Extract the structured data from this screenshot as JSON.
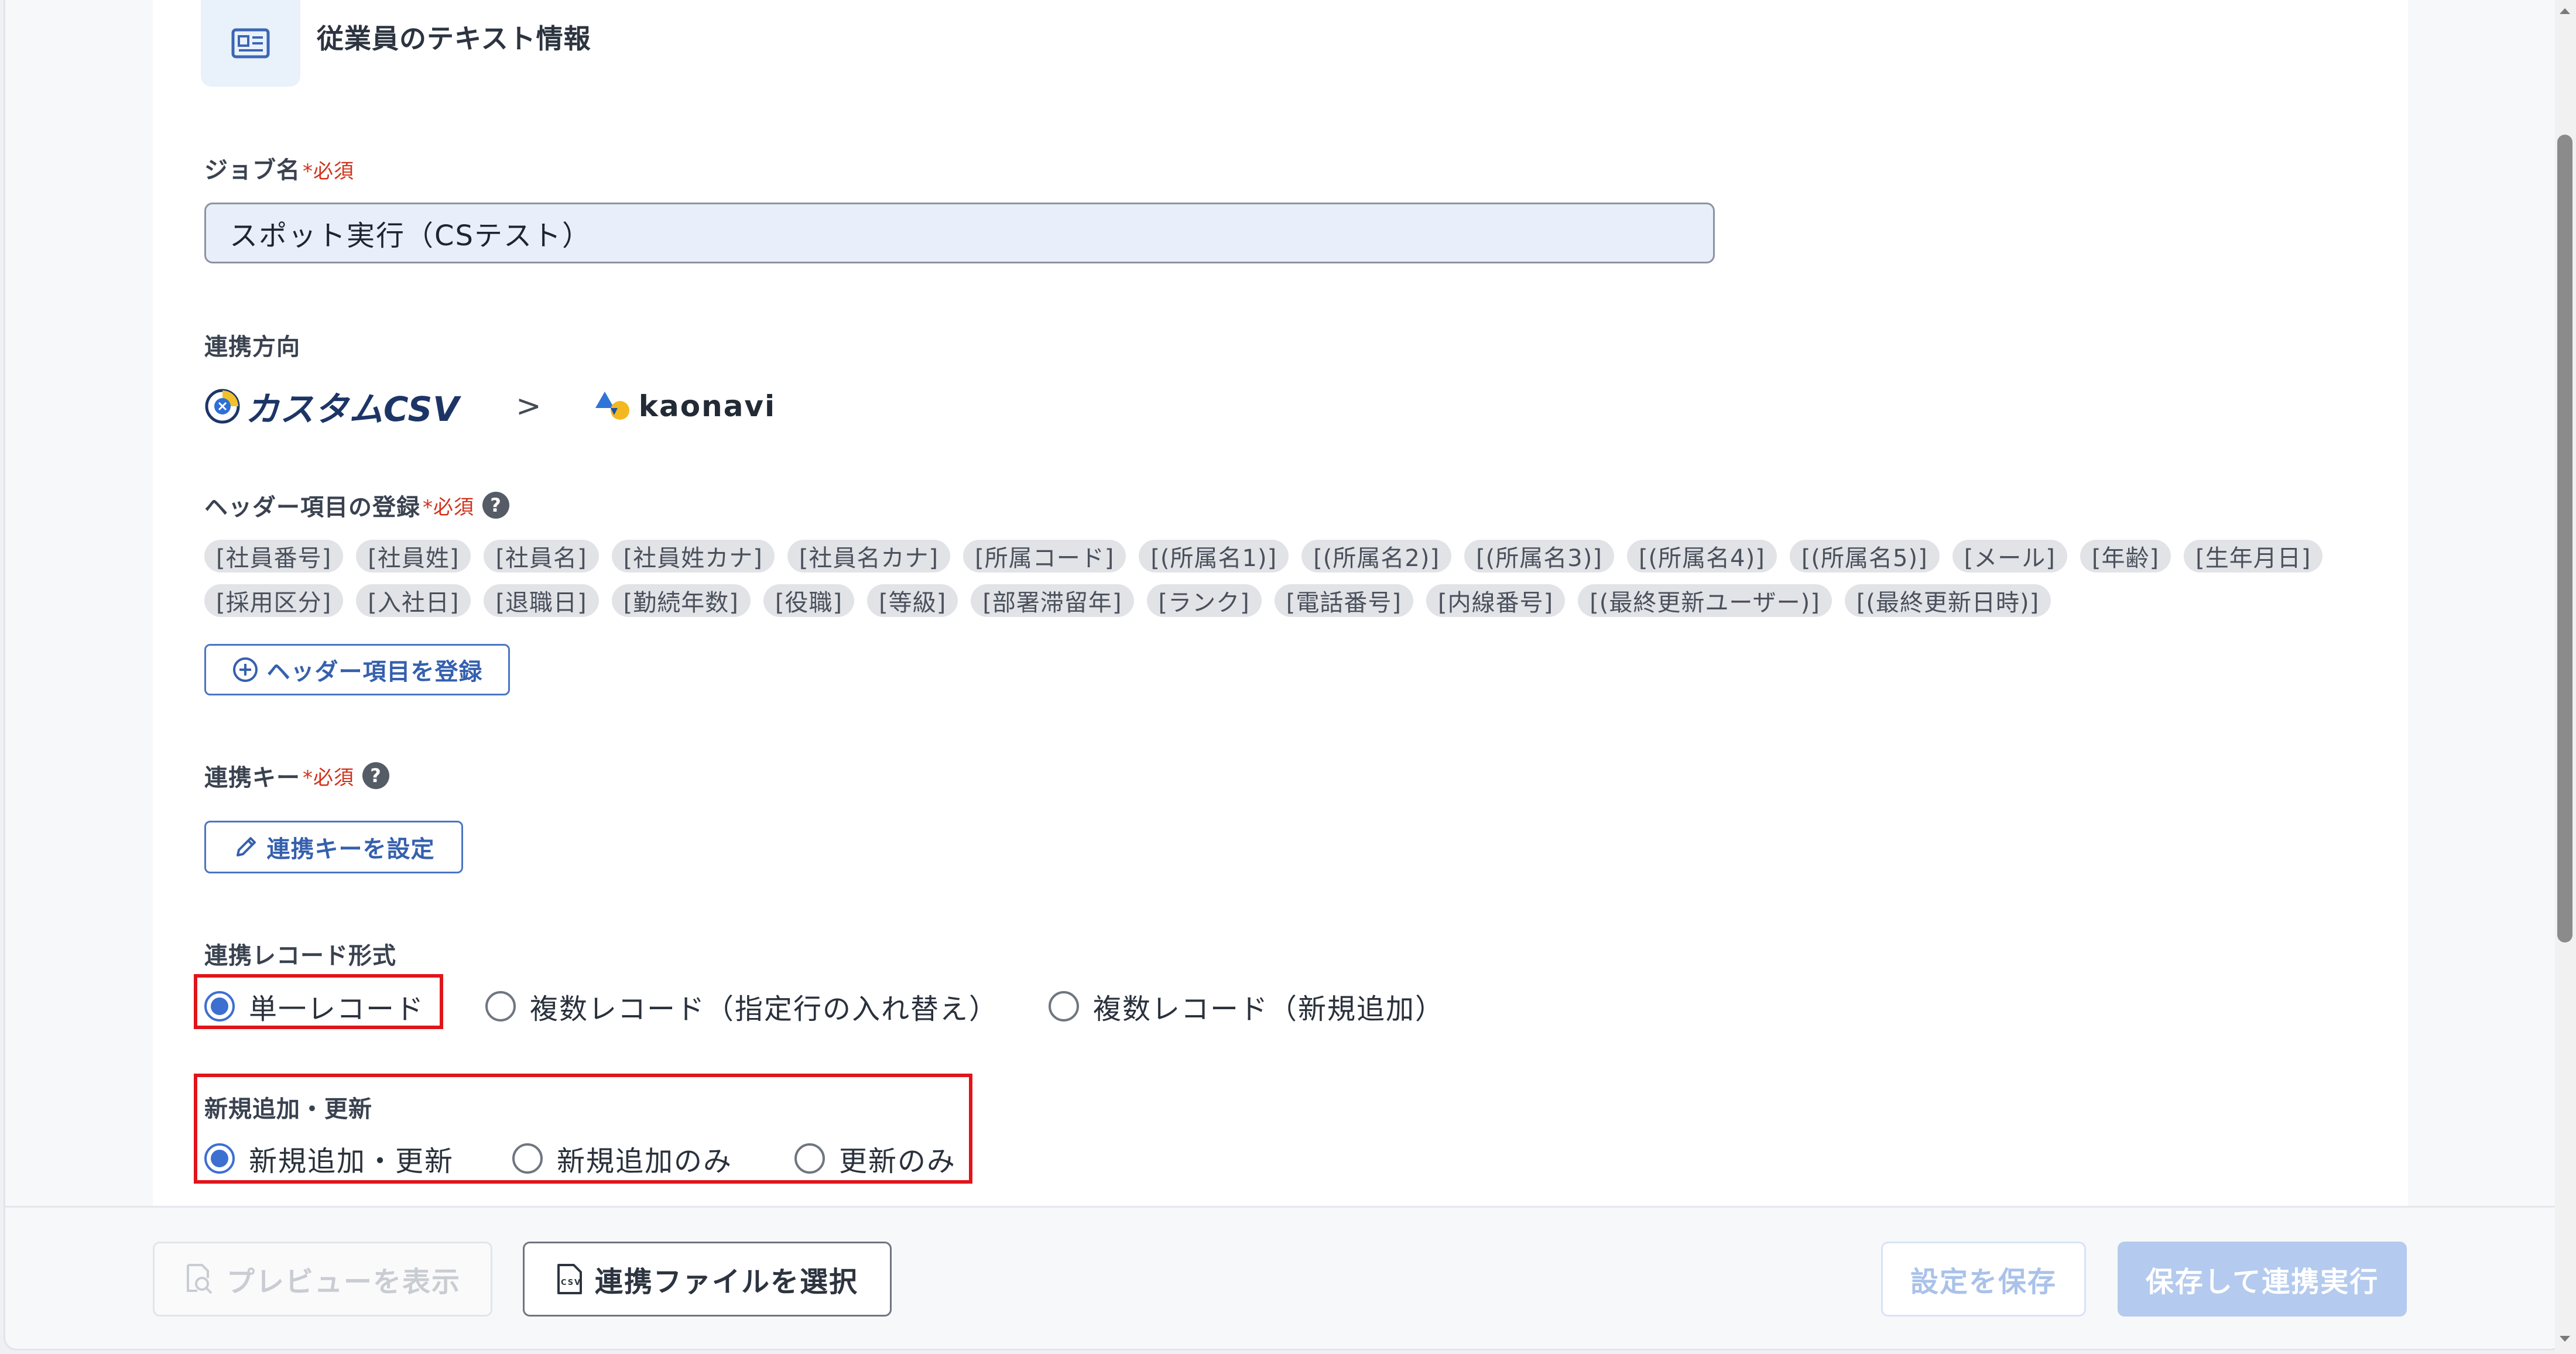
{
  "header": {
    "title": "従業員のテキスト情報",
    "icon": "id-card-icon"
  },
  "job_name": {
    "label": "ジョブ名",
    "required": "*必須",
    "value": "スポット実行（CSテスト）"
  },
  "direction": {
    "label": "連携方向",
    "source": "カスタムCSV",
    "arrow": ">",
    "target": "kaonavi"
  },
  "headers": {
    "label": "ヘッダー項目の登録",
    "required": "*必須",
    "help": "?",
    "tags": [
      "[社員番号]",
      "[社員姓]",
      "[社員名]",
      "[社員姓カナ]",
      "[社員名カナ]",
      "[所属コード]",
      "[(所属名1)]",
      "[(所属名2)]",
      "[(所属名3)]",
      "[(所属名4)]",
      "[(所属名5)]",
      "[メール]",
      "[年齢]",
      "[生年月日]",
      "[採用区分]",
      "[入社日]",
      "[退職日]",
      "[勤続年数]",
      "[役職]",
      "[等級]",
      "[部署滞留年]",
      "[ランク]",
      "[電話番号]",
      "[内線番号]",
      "[(最終更新ユーザー)]",
      "[(最終更新日時)]"
    ],
    "register_button": "ヘッダー項目を登録"
  },
  "key": {
    "label": "連携キー",
    "required": "*必須",
    "help": "?",
    "button": "連携キーを設定"
  },
  "record_format": {
    "label": "連携レコード形式",
    "options": [
      "単一レコード",
      "複数レコード（指定行の入れ替え）",
      "複数レコード（新規追加）"
    ],
    "selected": 0
  },
  "add_update": {
    "label": "新規追加・更新",
    "options": [
      "新規追加・更新",
      "新規追加のみ",
      "更新のみ"
    ],
    "selected": 0
  },
  "footer": {
    "preview": "プレビューを表示",
    "select_file": "連携ファイルを選択",
    "save": "設定を保存",
    "save_run": "保存して連携実行"
  },
  "colors": {
    "accent": "#3d6fd1",
    "required": "#d2321c",
    "highlight": "#e0151b"
  }
}
